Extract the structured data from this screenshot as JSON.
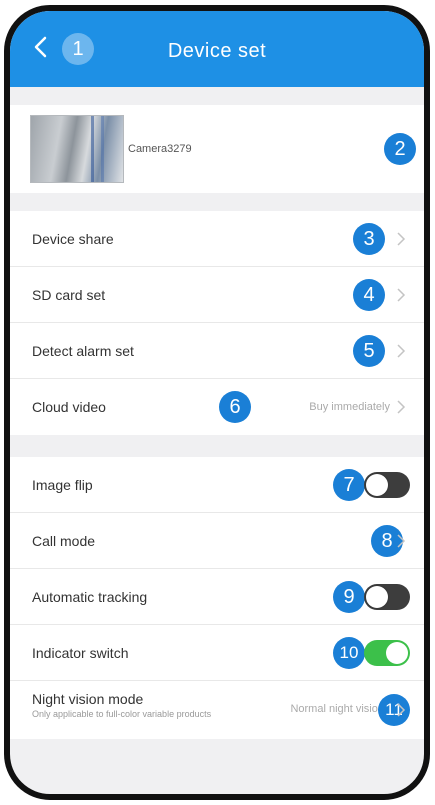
{
  "header": {
    "title": "Device set",
    "badge": "1"
  },
  "device": {
    "name": "Camera3279",
    "badge": "2"
  },
  "group1": [
    {
      "label": "Device share",
      "badge": "3"
    },
    {
      "label": "SD card set",
      "badge": "4"
    },
    {
      "label": "Detect alarm set",
      "badge": "5"
    },
    {
      "label": "Cloud video",
      "value": "Buy immediately",
      "badge": "6"
    }
  ],
  "group2": {
    "image_flip": {
      "label": "Image flip",
      "badge": "7",
      "state": "off"
    },
    "call_mode": {
      "label": "Call mode",
      "badge": "8"
    },
    "automatic_tracking": {
      "label": "Automatic tracking",
      "badge": "9",
      "state": "off"
    },
    "indicator_switch": {
      "label": "Indicator switch",
      "badge": "10",
      "state": "on"
    },
    "night_vision": {
      "label": "Night vision mode",
      "subtitle": "Only applicable to full-color variable products",
      "value": "Normal night vision",
      "badge": "11"
    }
  },
  "colors": {
    "header": "#1e90e5",
    "badge": "#1a7fd6",
    "toggle_on": "#3cc04a"
  }
}
